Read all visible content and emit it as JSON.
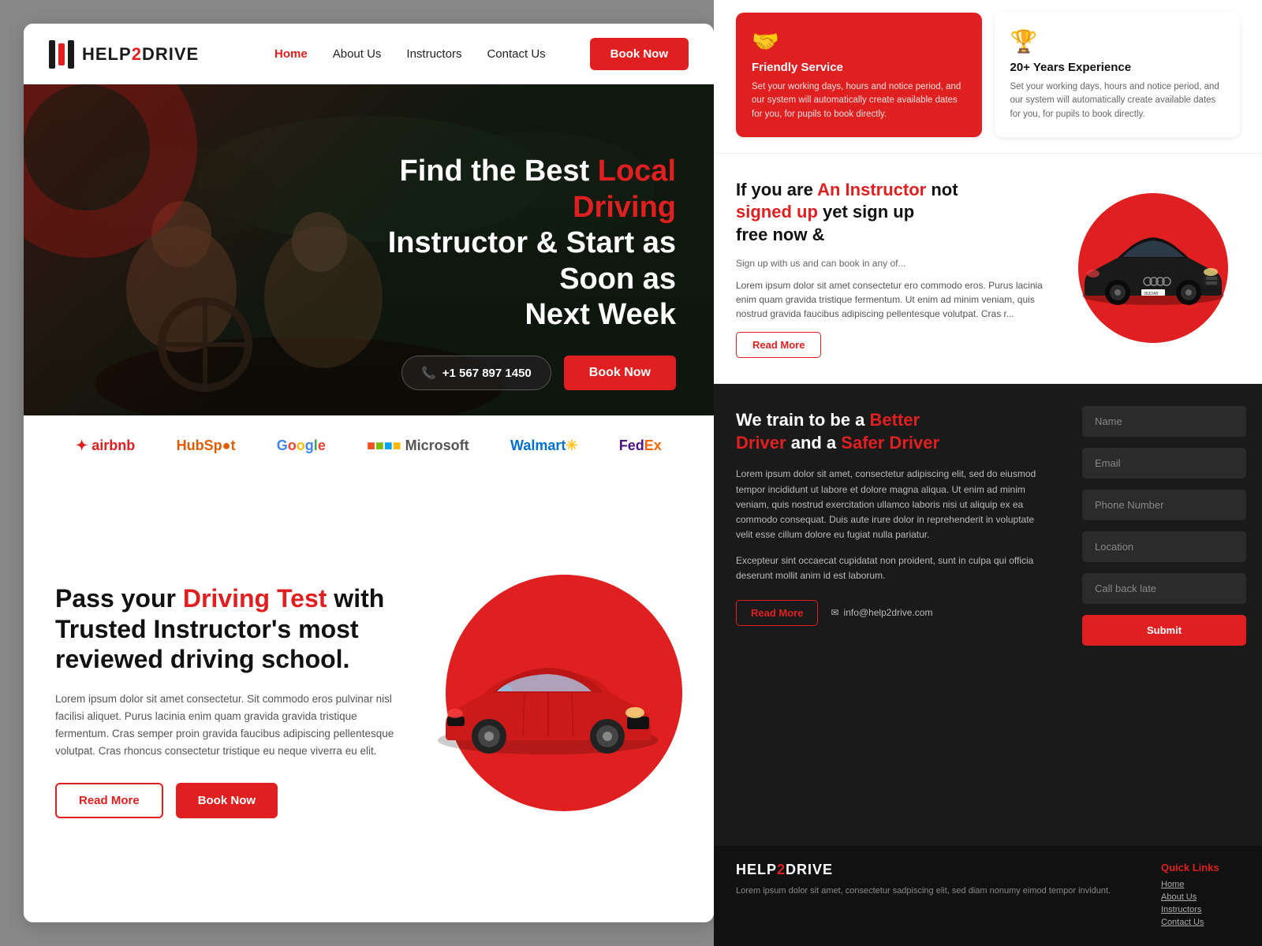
{
  "site": {
    "name": "HELP",
    "name2": "2",
    "name3": "DRIVE"
  },
  "navbar": {
    "home_label": "Home",
    "about_label": "About Us",
    "instructors_label": "Instructors",
    "contact_label": "Contact Us",
    "book_label": "Book Now"
  },
  "hero": {
    "title_1": "Find the Best ",
    "title_highlight": "Local Driving",
    "title_2": " Instructor & Start as Soon as Next Week",
    "phone": "+1 567 897 1450",
    "book_label": "Book Now"
  },
  "brands": [
    {
      "name": "airbnb",
      "display": "airbnb"
    },
    {
      "name": "hubspot",
      "display": "HubSpot"
    },
    {
      "name": "google",
      "display": "Google"
    },
    {
      "name": "microsoft",
      "display": "Microsoft"
    },
    {
      "name": "walmart",
      "display": "Walmart"
    },
    {
      "name": "fedex",
      "display": "FedEx"
    }
  ],
  "main_section": {
    "heading_1": "Pass your ",
    "heading_highlight": "Driving Test",
    "heading_2": " with Trusted Instructor's most reviewed driving school.",
    "body": "Lorem ipsum dolor sit amet consectetur. Sit commodo eros pulvinar nisl facilisi aliquet. Purus lacinia enim quam gravida gravida tristique fermentum. Cras semper proin gravida faucibus adipiscing pellentesque volutpat. Cras rhoncus consectetur tristique eu neque viverra eu elit.",
    "read_more_label": "Read More",
    "book_label": "Book Now"
  },
  "right_cards": [
    {
      "icon": "🤝",
      "title": "Friendly Service",
      "text": "Set your working days, hours and notice period, and our system will automatically create available dates for you, for pupils to book directly.",
      "style": "red"
    },
    {
      "icon": "🏆",
      "title": "20+ Years Experience",
      "text": "Set your working days, hours and notice period, and our system will automatically create available dates for you, for pupils to book directly.",
      "style": "white"
    }
  ],
  "instructor_promo": {
    "heading_1": "If you are ",
    "heading_highlight1": "An Instructor",
    "heading_2": " not",
    "heading_highlight2": " signed up",
    "heading_3": " yet sign up",
    "heading_4": " free now &",
    "body1": "Sign up with us and can book in any of...",
    "lorem": "Lorem ipsum dolor sit amet consectetur ero commodo eros. Purus lacinia enim quam gravida tristique fermentum. Ut enim ad minim veniam, quis nostrud gravida faucibus adipiscing pellentesque volutpat. Cras r...",
    "read_more_label": "Read More"
  },
  "form_section": {
    "heading_1": "We train to be a ",
    "heading_highlight1": "Better Driver",
    "heading_2": " and a ",
    "heading_highlight2": "Safer Driver",
    "body1": "Lorem ipsum dolor sit amet, consectetur adipiscing elit, sed do eiusmod tempor incididunt ut labore et dolore magna aliqua. Ut enim ad minim veniam, quis nostrud exercitation ullamco laboris nisi ut aliquip ex ea commodo consequat. Duis aute irure dolor in reprehenderit in voluptate velit esse cillum dolore eu fugiat nulla pariatur.",
    "body2": "Excepteur sint occaecat cupidatat non proident, sunt in culpa qui officia deserunt mollit anim id est laborum.",
    "read_more_label": "Read More",
    "email": "info@help2drive.com",
    "fields": {
      "name_placeholder": "Name",
      "email_placeholder": "Email",
      "phone_placeholder": "Phone Number",
      "location_placeholder": "Location",
      "callback_placeholder": "Call back late",
      "submit_label": "Submit"
    }
  },
  "footer": {
    "logo_text1": "HELP",
    "logo_text2": "2",
    "logo_text3": "DRIVE",
    "body": "Lorem ipsum dolor sit amet, consectetur sadpiscing elit, sed diam nonumy eimod tempor invidunt.",
    "quick_links_title": "Quick Links",
    "links": [
      "Home",
      "About Us",
      "Instructors",
      "Contact Us"
    ]
  }
}
